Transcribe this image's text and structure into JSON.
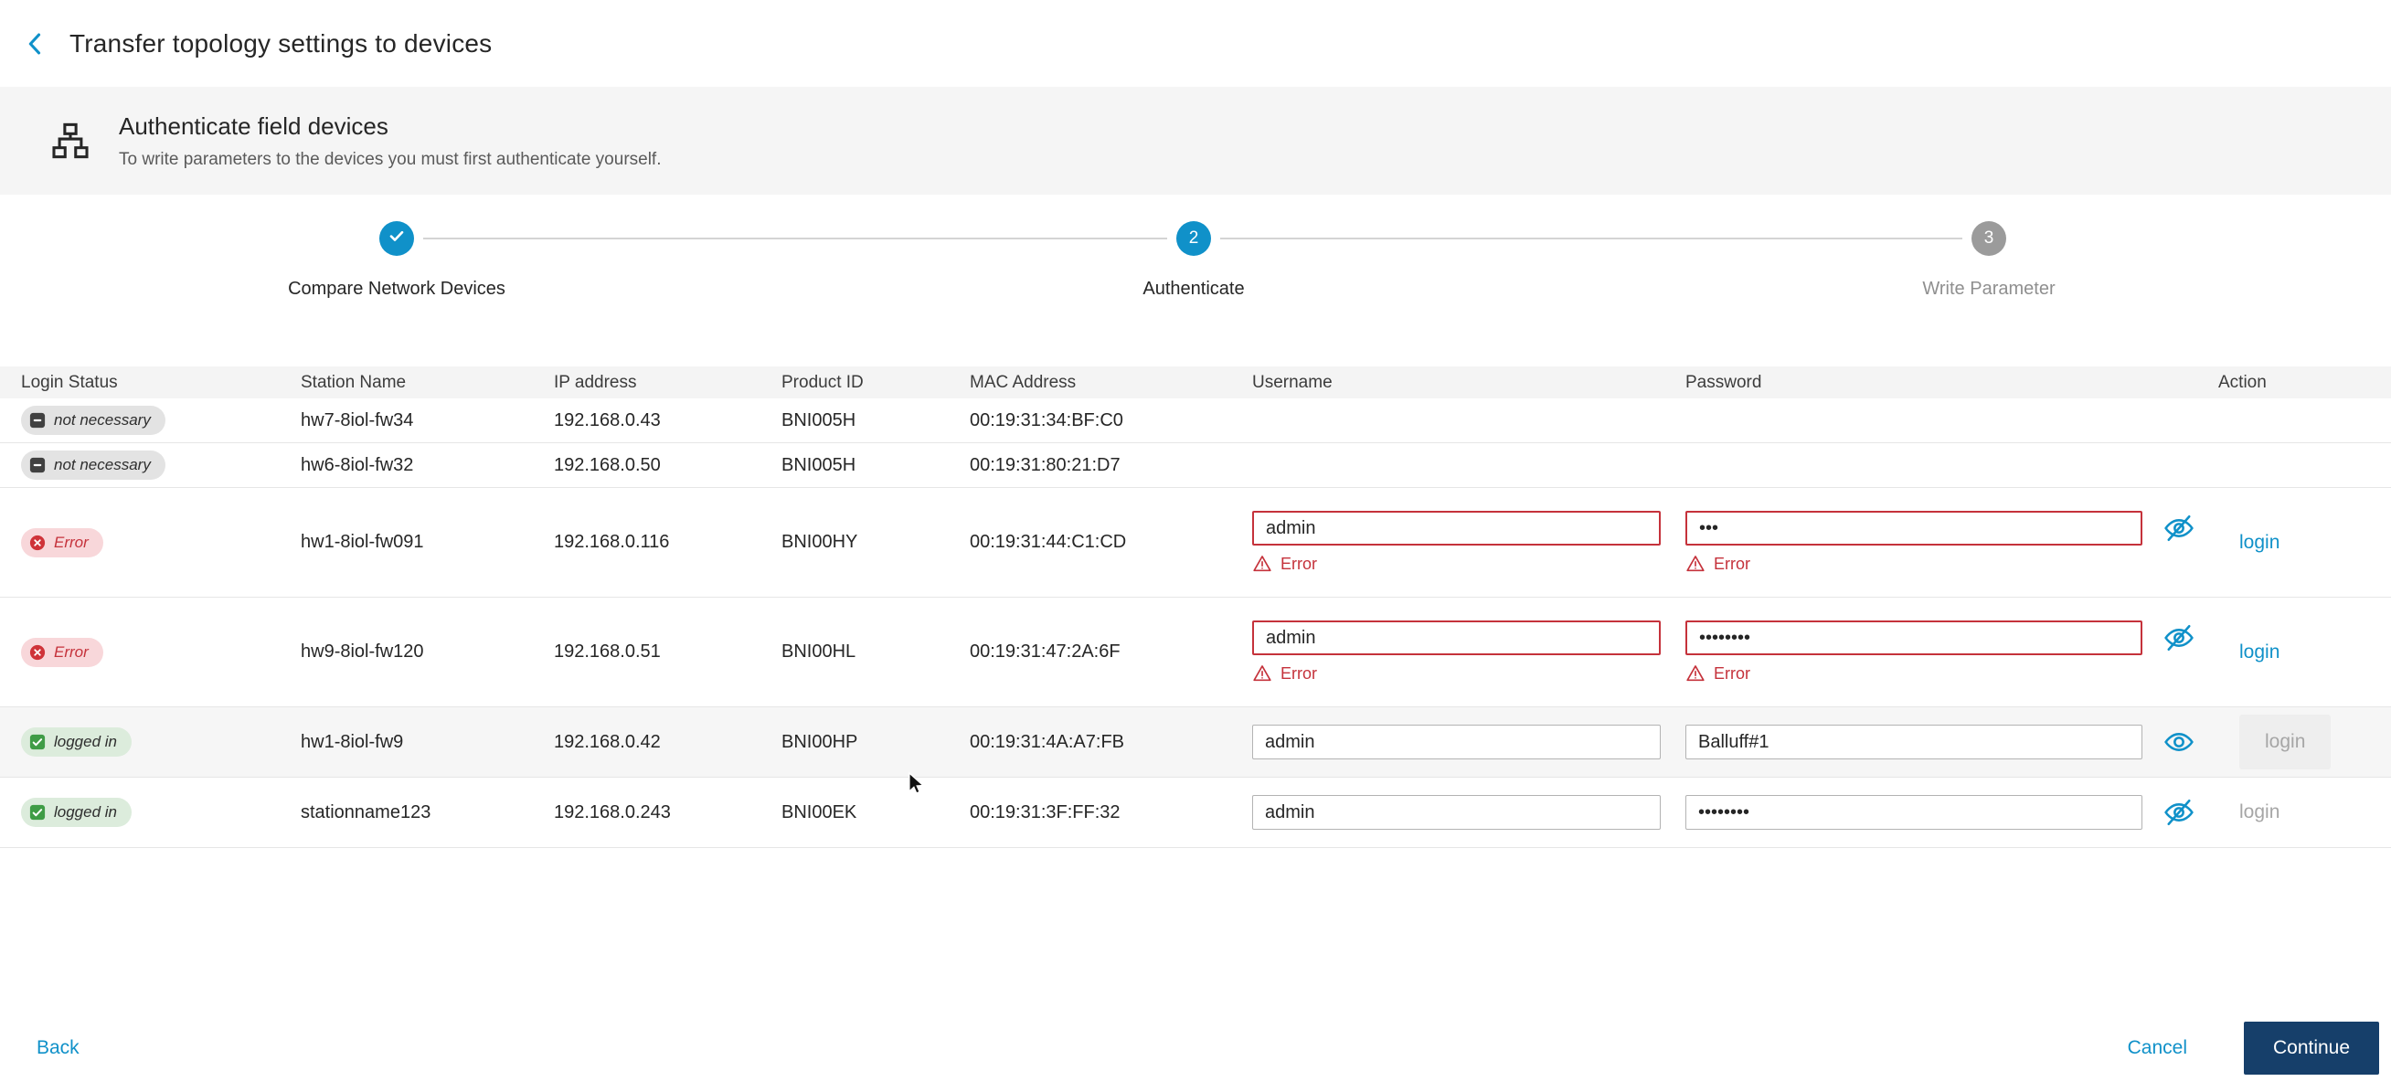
{
  "page": {
    "title": "Transfer topology settings to devices"
  },
  "banner": {
    "title": "Authenticate field devices",
    "subtitle": "To write parameters to the devices you must first authenticate yourself."
  },
  "stepper": {
    "steps": [
      {
        "number": "1",
        "label": "Compare Network Devices",
        "state": "done"
      },
      {
        "number": "2",
        "label": "Authenticate",
        "state": "active"
      },
      {
        "number": "3",
        "label": "Write Parameter",
        "state": "upcoming"
      }
    ]
  },
  "table": {
    "columns": [
      "Login Status",
      "Station Name",
      "IP address",
      "Product ID",
      "MAC Address",
      "Username",
      "Password",
      "Action"
    ],
    "rows": [
      {
        "size": "s",
        "highlighted": false,
        "status": {
          "label": "not necessary",
          "type": "neutral"
        },
        "station": "hw7-8iol-fw34",
        "ip": "192.168.0.43",
        "product": "BNI005H",
        "mac": "00:19:31:34:BF:C0",
        "auth": null,
        "action": null
      },
      {
        "size": "s",
        "highlighted": false,
        "status": {
          "label": "not necessary",
          "type": "neutral"
        },
        "station": "hw6-8iol-fw32",
        "ip": "192.168.0.50",
        "product": "BNI005H",
        "mac": "00:19:31:80:21:D7",
        "auth": null,
        "action": null
      },
      {
        "size": "l",
        "highlighted": false,
        "status": {
          "label": "Error",
          "type": "error"
        },
        "station": "hw1-8iol-fw091",
        "ip": "192.168.0.116",
        "product": "BNI00HY",
        "mac": "00:19:31:44:C1:CD",
        "auth": {
          "username": "admin",
          "password": "•••",
          "password_visible": false,
          "username_error": "Error",
          "password_error": "Error"
        },
        "action": {
          "label": "login",
          "enabled": true,
          "boxed": false
        }
      },
      {
        "size": "l",
        "highlighted": false,
        "status": {
          "label": "Error",
          "type": "error"
        },
        "station": "hw9-8iol-fw120",
        "ip": "192.168.0.51",
        "product": "BNI00HL",
        "mac": "00:19:31:47:2A:6F",
        "auth": {
          "username": "admin",
          "password": "••••••••",
          "password_visible": false,
          "username_error": "Error",
          "password_error": "Error"
        },
        "action": {
          "label": "login",
          "enabled": true,
          "boxed": false
        }
      },
      {
        "size": "m",
        "highlighted": true,
        "status": {
          "label": "logged in",
          "type": "success"
        },
        "station": "hw1-8iol-fw9",
        "ip": "192.168.0.42",
        "product": "BNI00HP",
        "mac": "00:19:31:4A:A7:FB",
        "auth": {
          "username": "admin",
          "password": "Balluff#1",
          "password_visible": true,
          "username_error": null,
          "password_error": null
        },
        "action": {
          "label": "login",
          "enabled": false,
          "boxed": true
        }
      },
      {
        "size": "m",
        "highlighted": false,
        "status": {
          "label": "logged in",
          "type": "success"
        },
        "station": "stationname123",
        "ip": "192.168.0.243",
        "product": "BNI00EK",
        "mac": "00:19:31:3F:FF:32",
        "auth": {
          "username": "admin",
          "password": "••••••••",
          "password_visible": false,
          "username_error": null,
          "password_error": null
        },
        "action": {
          "label": "login",
          "enabled": false,
          "boxed": false
        }
      }
    ]
  },
  "footer": {
    "back": "Back",
    "cancel": "Cancel",
    "continue_label": "Continue"
  },
  "colors": {
    "brand": "#1091c9",
    "continue_bg": "#163f6a",
    "error": "#c5323b",
    "error_badge_bg": "#f8d7da",
    "success_badge_bg": "#dcecdc",
    "neutral_badge_bg": "#e3e3e3"
  }
}
